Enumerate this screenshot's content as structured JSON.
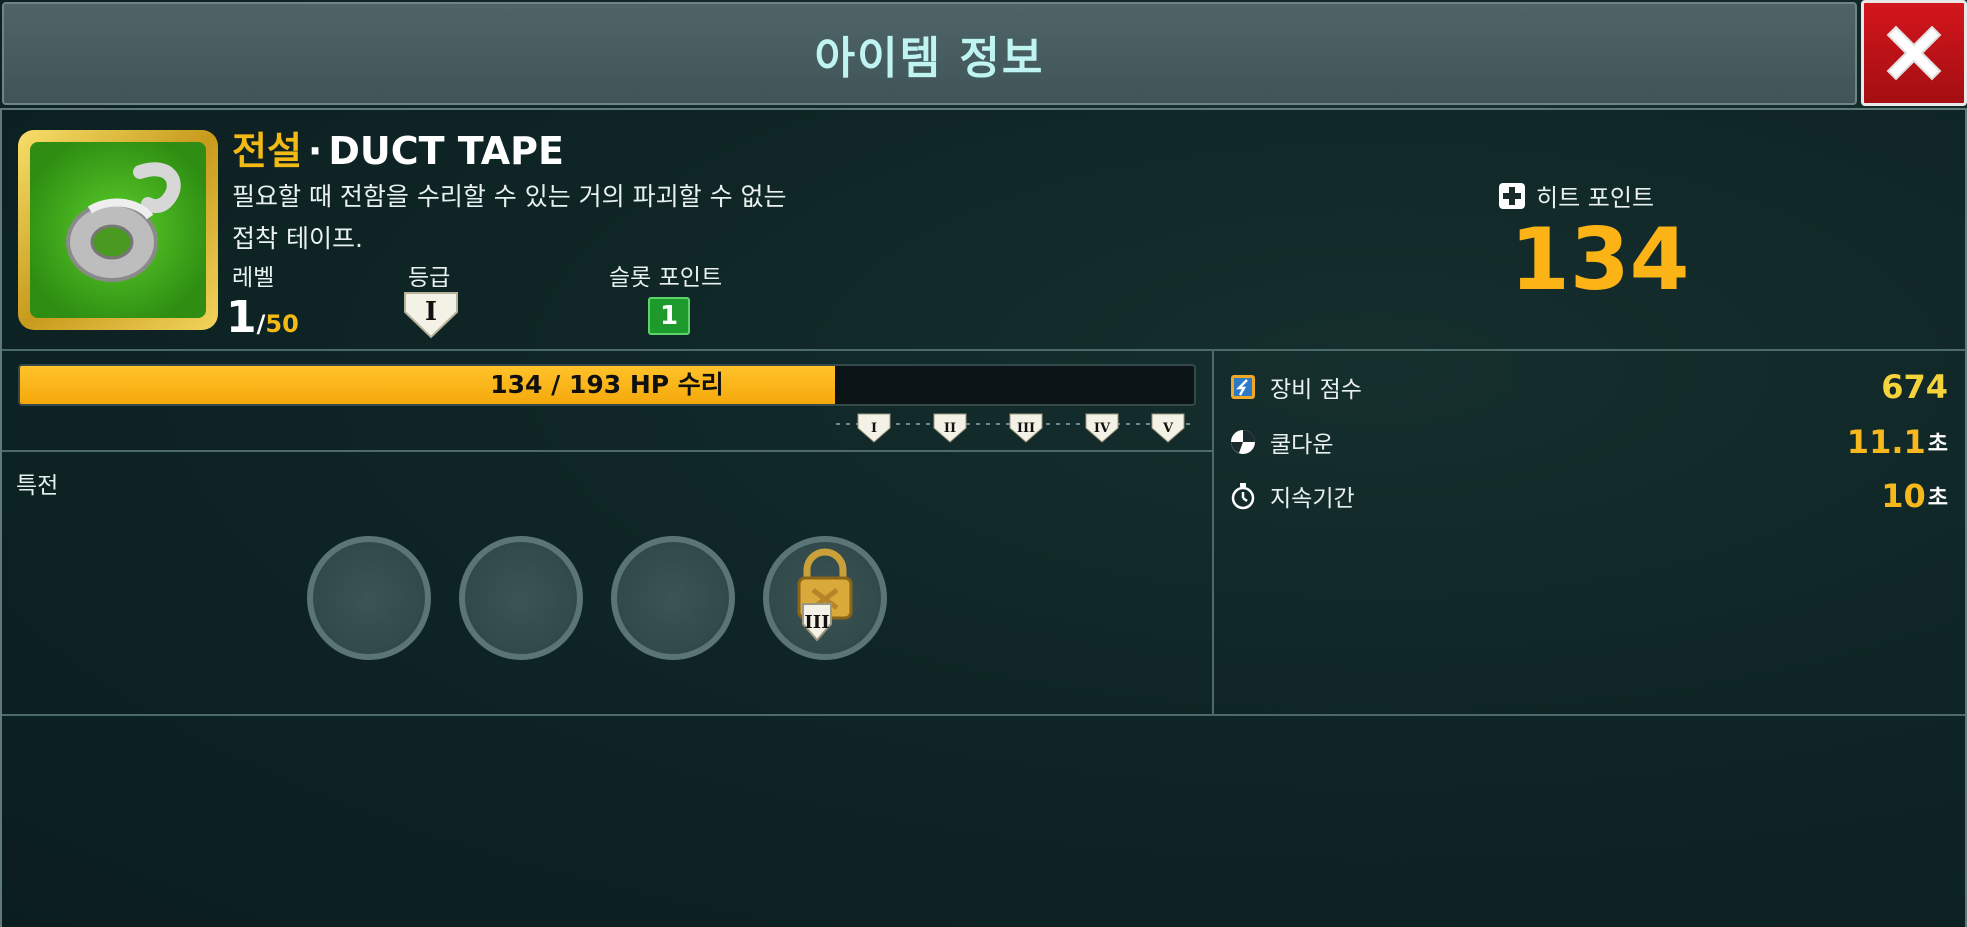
{
  "header": {
    "title": "아이템 정보",
    "close_icon": "close-x-icon"
  },
  "item": {
    "rarity": "전설",
    "separator": "·",
    "name": "DUCT TAPE",
    "description_line1": "필요할 때 전함을 수리할 수 있는 거의 파괴할 수 없는",
    "description_line2": "접착 테이프.",
    "icon": "duct-tape-icon",
    "rarity_color": "#f3b914"
  },
  "level": {
    "label": "레벨",
    "current": "1",
    "slash": "/",
    "max": "50"
  },
  "grade": {
    "label": "등급",
    "value": "I"
  },
  "slot_points": {
    "label": "슬롯 포인트",
    "value": "1"
  },
  "hit_points": {
    "label": "히트 포인트",
    "value": "134"
  },
  "repair": {
    "text": "134 / 193 HP 수리",
    "current": 134,
    "max": 193,
    "progress": 0.694,
    "tiers": [
      "I",
      "II",
      "III",
      "IV",
      "V"
    ]
  },
  "perks": {
    "label": "특전",
    "slots": [
      {
        "state": "empty"
      },
      {
        "state": "empty"
      },
      {
        "state": "empty"
      },
      {
        "state": "locked",
        "required_tier": "III"
      }
    ]
  },
  "stats": [
    {
      "label": "장비 점수",
      "value": "674",
      "unit": "",
      "icon": "gear-score-icon"
    },
    {
      "label": "쿨다운",
      "value": "11.1",
      "unit": "초",
      "icon": "cooldown-icon"
    },
    {
      "label": "지속기간",
      "value": "10",
      "unit": "초",
      "icon": "stopwatch-icon"
    }
  ]
}
